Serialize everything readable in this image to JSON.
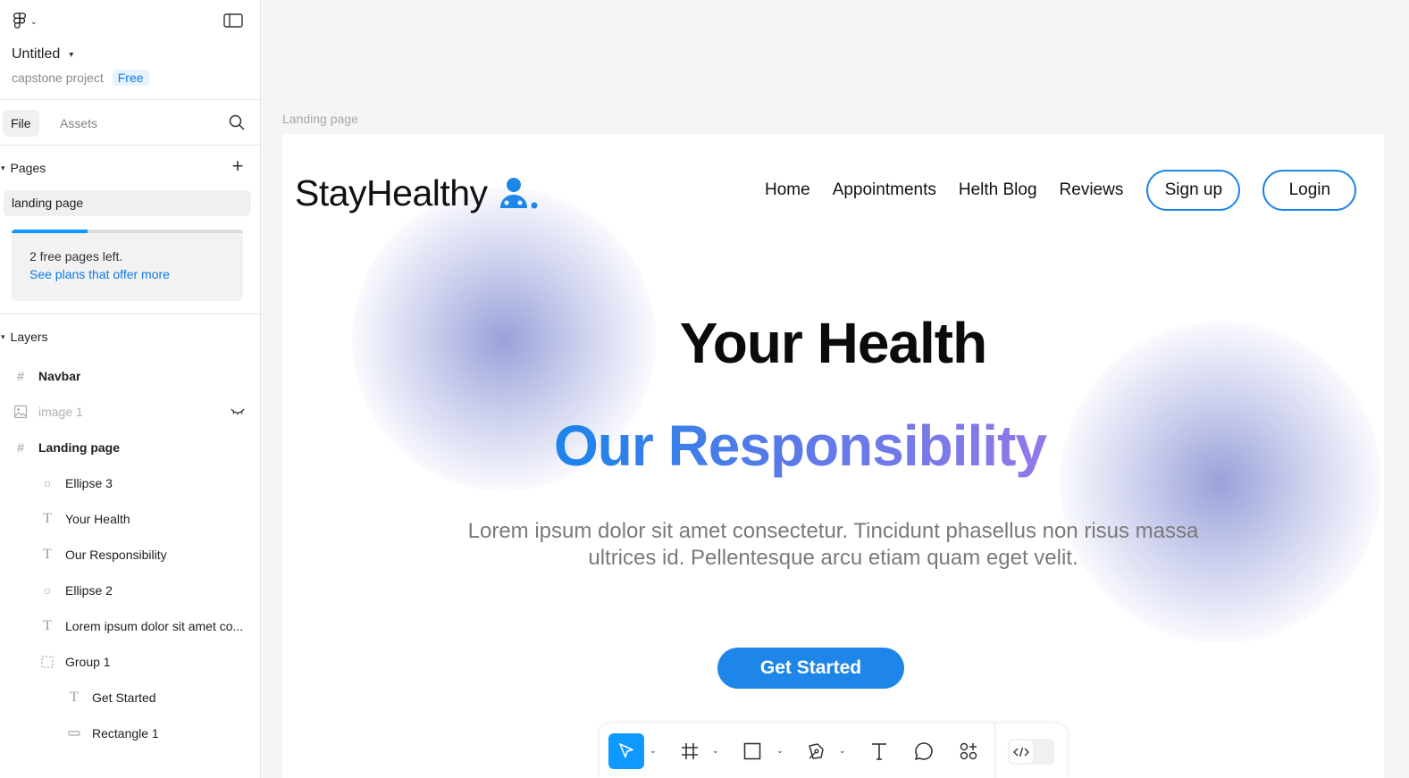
{
  "file": {
    "title": "Untitled",
    "project": "capstone project",
    "plan_badge": "Free"
  },
  "tabs": {
    "file": "File",
    "assets": "Assets"
  },
  "pages": {
    "header": "Pages",
    "items": [
      "landing page"
    ],
    "quota_used_fraction": 0.33,
    "quota_text": "2 free pages left.",
    "quota_link": "See plans that offer more"
  },
  "layers": {
    "header": "Layers",
    "items": [
      {
        "name": "Navbar",
        "icon": "frame-icon"
      },
      {
        "name": "image 1",
        "icon": "image-icon",
        "hidden": true
      },
      {
        "name": "Landing page",
        "icon": "frame-icon"
      },
      {
        "name": "Ellipse 3",
        "icon": "ellipse-icon"
      },
      {
        "name": "Your Health",
        "icon": "text-icon"
      },
      {
        "name": "Our Responsibility",
        "icon": "text-icon"
      },
      {
        "name": "Ellipse 2",
        "icon": "ellipse-icon"
      },
      {
        "name": "Lorem ipsum dolor sit amet co...",
        "icon": "text-icon"
      },
      {
        "name": "Group 1",
        "icon": "group-icon"
      },
      {
        "name": "Get Started",
        "icon": "text-icon"
      },
      {
        "name": "Rectangle 1",
        "icon": "rectangle-icon"
      }
    ]
  },
  "canvas": {
    "frame_label": "Landing page",
    "brand": "StayHealthy",
    "nav": {
      "links": [
        "Home",
        "Appointments",
        "Helth Blog",
        "Reviews"
      ],
      "signup": "Sign up",
      "login": "Login"
    },
    "hero_line1": "Your Health",
    "hero_line2": "Our Responsibility",
    "lorem": "Lorem ipsum dolor sit amet consectetur. Tincidunt phasellus non risus massa ultrices id. Pellentesque arcu etiam quam eget velit.",
    "cta": "Get Started"
  },
  "colors": {
    "accent": "#0d99ff",
    "brand_blue": "#1e86e8",
    "gradient_start": "#1a84ea",
    "gradient_end": "#9b78e8"
  },
  "toolbar": {
    "tools": [
      "move-tool",
      "frame-tool",
      "rectangle-tool",
      "pen-tool",
      "text-tool",
      "comment-tool",
      "actions-tool",
      "dev-mode-toggle"
    ]
  }
}
